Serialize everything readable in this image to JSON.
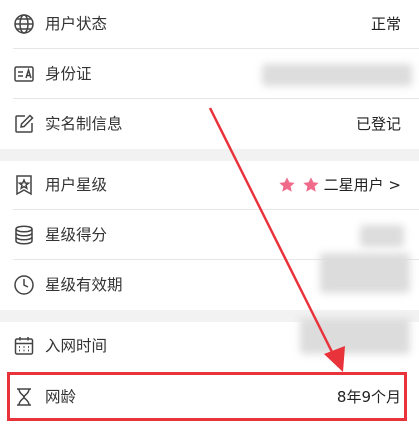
{
  "rows": [
    {
      "label": "用户状态",
      "value": "正常",
      "icon": "globe-icon"
    },
    {
      "label": "身份证",
      "value": "",
      "icon": "id-card-icon"
    },
    {
      "label": "实名制信息",
      "value": "已登记",
      "icon": "edit-icon"
    },
    {
      "label": "用户星级",
      "value": "二星用户 >",
      "icon": "star-badge-icon"
    },
    {
      "label": "星级得分",
      "value": "",
      "icon": "coin-stack-icon"
    },
    {
      "label": "星级有效期",
      "value": "",
      "icon": "clock-icon"
    },
    {
      "label": "入网时间",
      "value": "",
      "icon": "calendar-icon"
    },
    {
      "label": "网龄",
      "value": "8年9个月",
      "icon": "hourglass-icon"
    }
  ],
  "colors": {
    "accent_red": "#e8333a",
    "star_pink": "#f06a8c",
    "divider": "#e6e6e6",
    "background": "#f2f2f2"
  }
}
